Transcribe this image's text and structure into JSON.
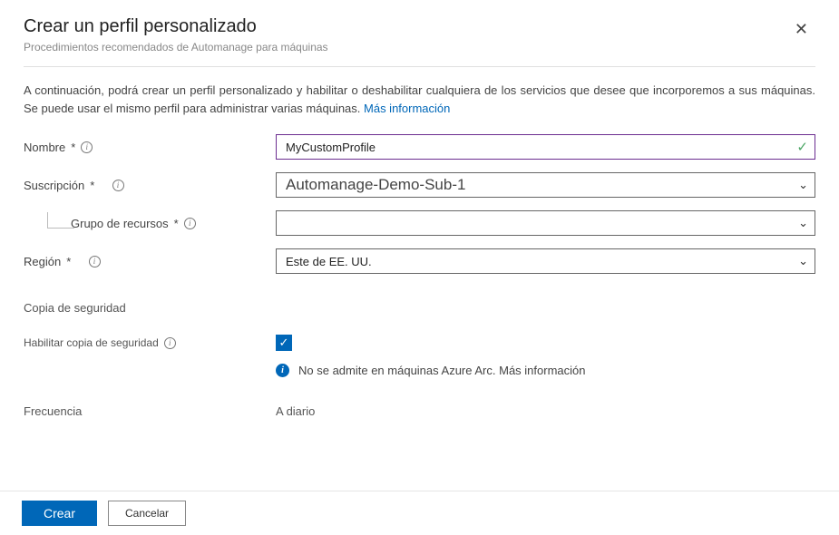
{
  "header": {
    "title": "Crear un perfil personalizado",
    "subtitle": "Procedimientos recomendados de Automanage para máquinas"
  },
  "description": {
    "text": "A continuación, podrá crear un perfil personalizado y habilitar o deshabilitar cualquiera de los servicios que desee que incorporemos a sus máquinas. Se puede usar el mismo perfil para administrar varias máquinas.",
    "link": "Más información"
  },
  "form": {
    "name_label": "Nombre",
    "name_value": "MyCustomProfile",
    "subscription_label": "Suscripción",
    "subscription_value": "Automanage-Demo-Sub-1",
    "resource_group_label": "Grupo de recursos",
    "resource_group_value": "",
    "region_label": "Región",
    "region_value": "Este de EE. UU."
  },
  "backup": {
    "section": "Copia de seguridad",
    "enable_label": "Habilitar copia de seguridad",
    "helper_text": "No se admite en máquinas Azure Arc. Más información",
    "frequency_label": "Frecuencia",
    "frequency_value": "A diario"
  },
  "footer": {
    "create": "Crear",
    "cancel": "Cancelar"
  }
}
